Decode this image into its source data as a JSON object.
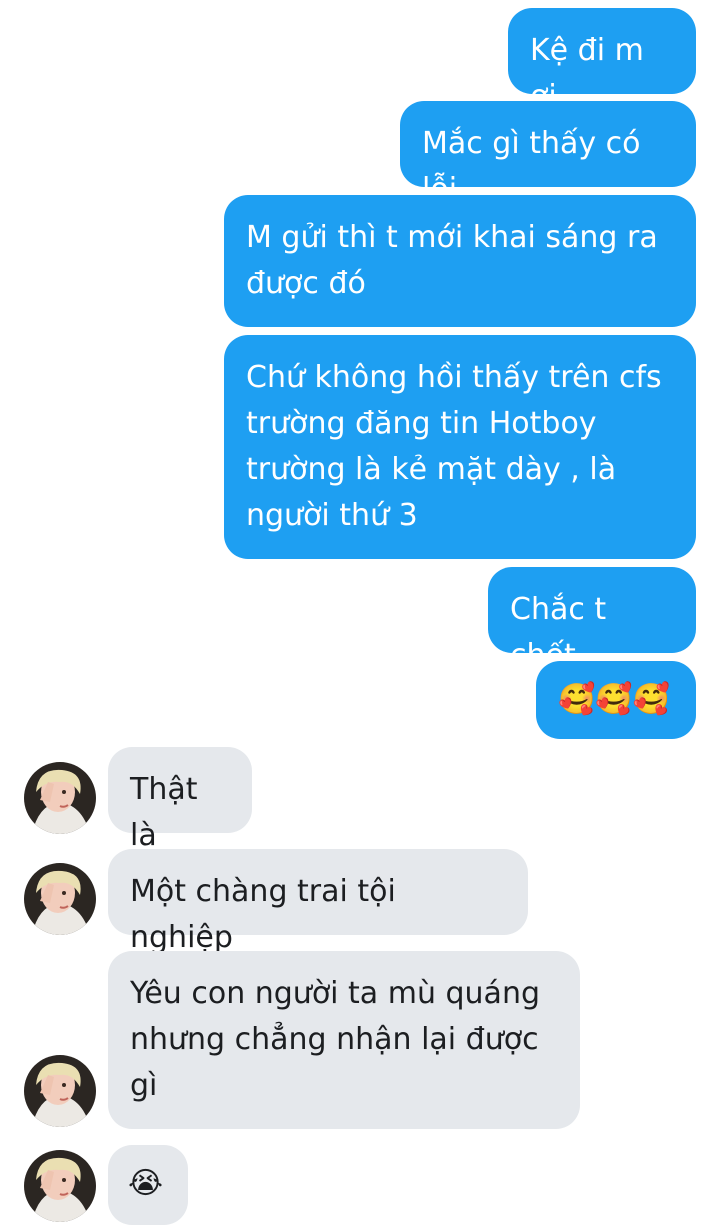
{
  "conversation": {
    "sent": [
      {
        "text": "Kệ đi m ơi"
      },
      {
        "text": "Mắc gì thấy có lỗi"
      },
      {
        "text": "M gửi thì t mới khai sáng ra được đó"
      },
      {
        "text": "Chứ không hồi thấy trên cfs trường đăng tin Hotboy trường là kẻ mặt dày , là người thứ 3"
      },
      {
        "text": "Chắc t chết"
      },
      {
        "text": "🥰🥰🥰"
      }
    ],
    "received": [
      {
        "text": "Thật là"
      },
      {
        "text": "Một chàng trai tội nghiệp"
      },
      {
        "text": "Yêu con người ta mù quáng nhưng chẳng nhận lại được gì"
      },
      {
        "text": "😭"
      }
    ]
  },
  "colors": {
    "sent_bubble": "#1e9ff2",
    "received_bubble": "#e5e8ec",
    "received_text": "#1c1e21"
  },
  "icons": {
    "avatar": "contact-avatar-photo"
  }
}
